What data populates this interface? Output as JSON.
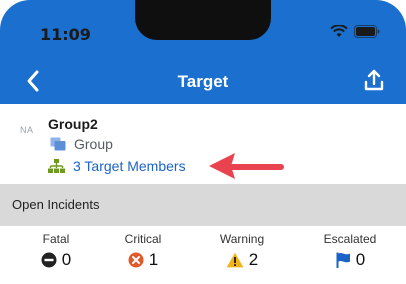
{
  "status_bar": {
    "time": "11:09"
  },
  "nav": {
    "title": "Target"
  },
  "group": {
    "avatar_text": "NA",
    "name": "Group2",
    "type": "Group",
    "members_link": "3 Target Members"
  },
  "open_incidents": {
    "header": "Open Incidents",
    "items": [
      {
        "label": "Fatal",
        "count": "0",
        "icon": "minus-circle-icon",
        "color": "#222222"
      },
      {
        "label": "Critical",
        "count": "1",
        "icon": "x-circle-icon",
        "color": "#e05a2b"
      },
      {
        "label": "Warning",
        "count": "2",
        "icon": "warning-triangle-icon",
        "color": "#f3b31b"
      },
      {
        "label": "Escalated",
        "count": "0",
        "icon": "flag-icon",
        "color": "#1a64c8"
      }
    ]
  },
  "colors": {
    "nav_bar": "#1a6fcf",
    "link": "#1a64c8",
    "section_header": "#d9d9d9",
    "annotation_arrow": "#e8434f"
  }
}
